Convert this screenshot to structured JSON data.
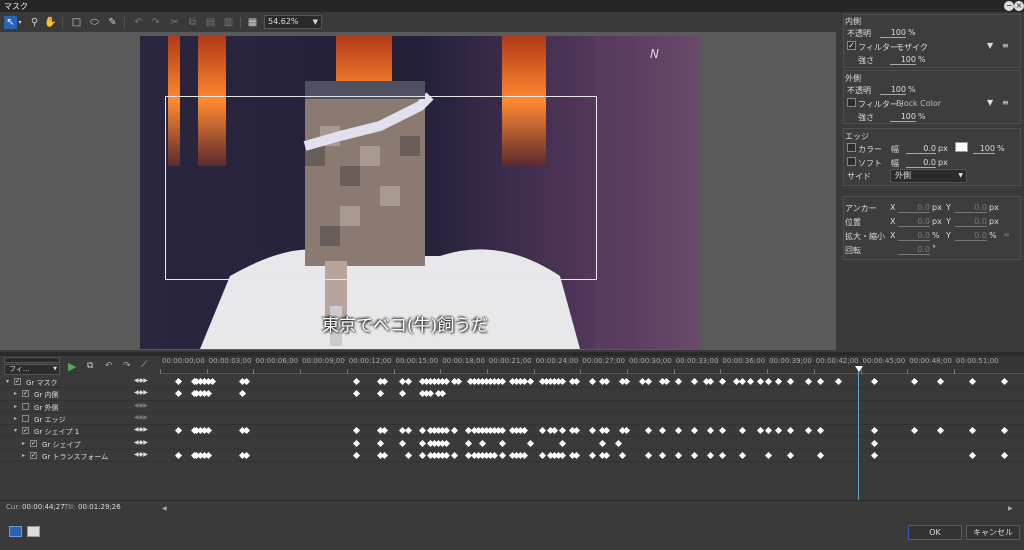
{
  "window": {
    "title": "マスク",
    "close_icon": "circle-close-icon",
    "min_icon": "circle-minimize-icon"
  },
  "toolbar": {
    "zoom": "54.62%",
    "icons": [
      "select-arrow-icon",
      "zoom-icon",
      "hand-icon",
      "rectangle-icon",
      "ellipse-icon",
      "pen-icon",
      "undo-icon",
      "redo-icon",
      "cut-icon",
      "copy-icon",
      "paste-icon",
      "delete-icon",
      "clear-icon",
      "grid-icon"
    ]
  },
  "preview": {
    "subtitle": "東京でベコ(牛)飼うだ"
  },
  "inner": {
    "title": "内側",
    "opacity_label": "不透明",
    "opacity_value": "100",
    "opacity_unit": "%",
    "filter_label": "フィルター :",
    "filter_value": "モザイク",
    "strength_label": "強さ",
    "strength_value": "100",
    "strength_unit": "%"
  },
  "outer": {
    "title": "外側",
    "opacity_label": "不透明",
    "opacity_value": "100",
    "opacity_unit": "%",
    "filter_label": "フィルター :",
    "filter_value": "Block Color",
    "strength_label": "強さ",
    "strength_value": "100",
    "strength_unit": "%"
  },
  "edge": {
    "title": "エッジ",
    "color_label": "カラー",
    "width_label": "幅",
    "color_width": "0.0",
    "px": "px",
    "color_opacity": "100",
    "pct": "%",
    "soft_label": "ソフト",
    "soft_width": "0.0",
    "side_label": "サイド",
    "side_value": "外側",
    "swatch_color": "#ffffff"
  },
  "transform": {
    "anchor_label": "アンカー",
    "position_label": "位置",
    "scale_label": "拡大・縮小",
    "rotation_label": "回転",
    "x": "X",
    "y": "Y",
    "val": "0.0",
    "px": "px",
    "pct": "%",
    "deg": "°"
  },
  "timeline": {
    "dropdown": "フィ...",
    "ruler": [
      "00:00:00;00",
      "00:00:03;00",
      "00:00:06;00",
      "00:00:09;00",
      "00:00:12;00",
      "00:00:15;00",
      "00:00:18;00",
      "00:00:21;00",
      "00:00:24;00",
      "00:00:27;00",
      "00:00:30;00",
      "00:00:33;00",
      "00:00:36;00",
      "00:00:39;00",
      "00:00:42;00",
      "00:00:45;00",
      "00:00:48;00",
      "00:00:51;00"
    ],
    "tracks": [
      {
        "name": "マスク",
        "indent": 0
      },
      {
        "name": "内側",
        "indent": 1
      },
      {
        "name": "外側",
        "indent": 1
      },
      {
        "name": "エッジ",
        "indent": 1
      },
      {
        "name": "シェイプ 1",
        "indent": 1
      },
      {
        "name": "シェイプ",
        "indent": 2
      },
      {
        "name": "トランスフォーム",
        "indent": 2
      }
    ]
  },
  "status": {
    "cur_label": "Cur:",
    "cur": "00:00:44;27",
    "ttl_label": "Ttl:",
    "ttl": "00:01:29;26"
  },
  "buttons": {
    "ok": "OK",
    "cancel": "キャンセル"
  },
  "colors": {
    "accent": "#2b63b8",
    "playhead": "#56a8c7",
    "play": "#4caf50"
  }
}
